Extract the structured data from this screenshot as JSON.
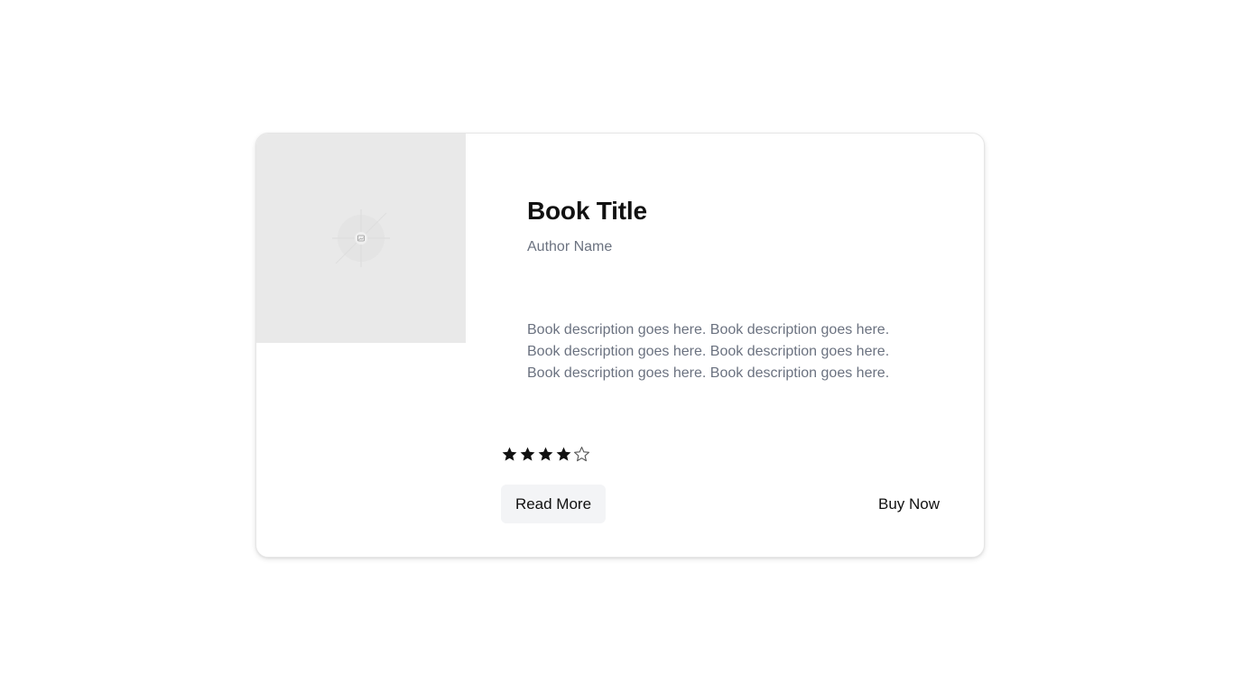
{
  "book": {
    "title": "Book Title",
    "author": "Author Name",
    "description": "Book description goes here. Book description goes here. Book description goes here. Book description goes here. Book description goes here. Book description goes here.",
    "cover_icon": "image-placeholder-icon",
    "rating": {
      "value": 4,
      "max": 5
    }
  },
  "actions": {
    "read_more_label": "Read More",
    "buy_now_label": "Buy Now"
  },
  "colors": {
    "title": "#111111",
    "muted_text": "#6b7280",
    "cover_placeholder": "#e9e9e9",
    "secondary_button_bg": "#f3f4f6",
    "star_filled": "#111111",
    "star_empty": "#555555"
  }
}
